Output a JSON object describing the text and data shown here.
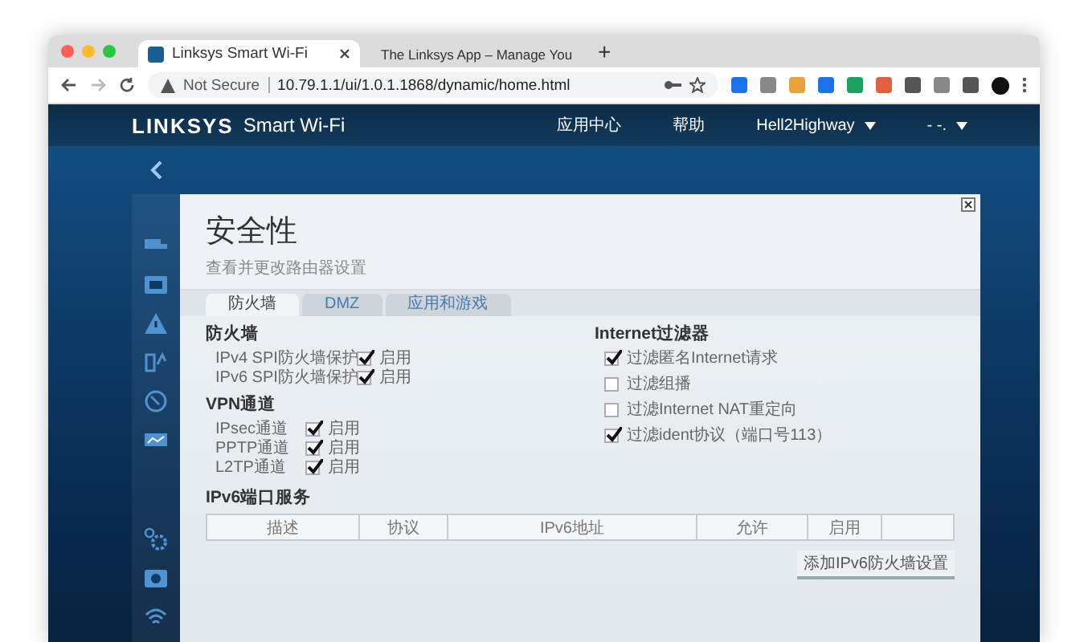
{
  "browser": {
    "tabs": [
      {
        "title": "Linksys Smart Wi-Fi",
        "selected": true
      },
      {
        "title": "The Linksys App – Manage You",
        "selected": false
      }
    ],
    "new_tab": "+",
    "security_label": "Not Secure",
    "url": "10.79.1.1/ui/1.0.1.1868/dynamic/home.html"
  },
  "header": {
    "logo": "LINKSYS",
    "product": "Smart Wi-Fi",
    "nav": [
      "应用中心",
      "帮助"
    ],
    "user": "Hell2Highway",
    "language": "- -."
  },
  "panel": {
    "title": "安全性",
    "subtitle": "查看并更改路由器设置",
    "tabs": [
      {
        "label": "防火墙",
        "selected": true
      },
      {
        "label": "DMZ",
        "selected": false
      },
      {
        "label": "应用和游戏",
        "selected": false
      }
    ],
    "firewall": {
      "heading": "防火墙",
      "rows": [
        {
          "label": "IPv4 SPI防火墙保护",
          "option": "启用",
          "checked": true
        },
        {
          "label": "IPv6 SPI防火墙保护",
          "option": "启用",
          "checked": true
        }
      ]
    },
    "vpn": {
      "heading": "VPN通道",
      "rows": [
        {
          "label": "IPsec通道",
          "option": "启用",
          "checked": true
        },
        {
          "label": "PPTP通道",
          "option": "启用",
          "checked": true
        },
        {
          "label": "L2TP通道",
          "option": "启用",
          "checked": true
        }
      ]
    },
    "internet_filter": {
      "heading": "Internet过滤器",
      "rows": [
        {
          "label": "过滤匿名Internet请求",
          "checked": true
        },
        {
          "label": "过滤组播",
          "checked": false
        },
        {
          "label": "过滤Internet NAT重定向",
          "checked": false
        },
        {
          "label": "过滤ident协议（端口号113）",
          "checked": true
        }
      ]
    },
    "ipv6_ports": {
      "heading": "IPv6端口服务",
      "columns": [
        "描述",
        "协议",
        "IPv6地址",
        "允许",
        "启用"
      ],
      "add_button": "添加IPv6防火墙设置"
    }
  }
}
